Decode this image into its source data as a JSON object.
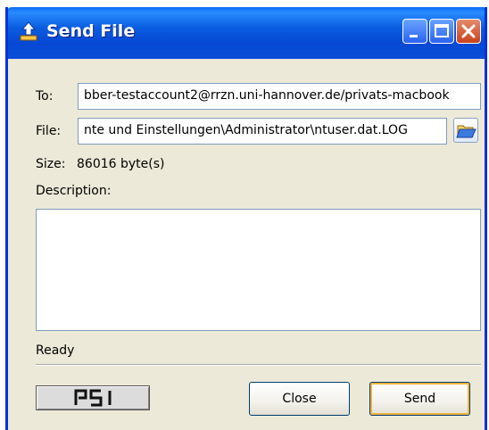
{
  "window": {
    "title": "Send File"
  },
  "form": {
    "to_label": "To:",
    "to_value": "bber-testaccount2@rrzn.uni-hannover.de/privats-macbook",
    "file_label": "File:",
    "file_value": "nte und Einstellungen\\Administrator\\ntuser.dat.LOG",
    "size_label": "Size:",
    "size_value": "86016 byte(s)",
    "description_label": "Description:",
    "description_value": ""
  },
  "status": {
    "text": "Ready"
  },
  "logo": {
    "text": "PSI"
  },
  "buttons": {
    "close_label": "Close",
    "send_label": "Send"
  },
  "icons": {
    "title_icon": "upload-arrow-icon",
    "browse_icon": "folder-open-icon",
    "minimize": "minimize-icon",
    "maximize": "maximize-icon",
    "close": "close-icon"
  },
  "colors": {
    "titlebar": "#0a5de0",
    "window_border": "#0831d9",
    "dialog_bg": "#ece9d8",
    "close_button": "#c9421c",
    "default_button_ring": "#f2b43c"
  }
}
